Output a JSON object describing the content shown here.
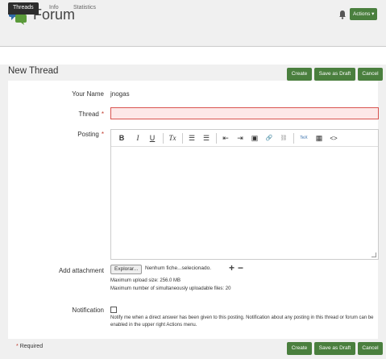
{
  "header": {
    "app_title": "Forum",
    "actions_label": "Actions ▾",
    "bell_icon": "bell-icon",
    "logo_icon": "forum-chat-icon"
  },
  "tabs": [
    {
      "label": "Threads",
      "active": true
    },
    {
      "label": "Info",
      "active": false
    },
    {
      "label": "Statistics",
      "active": false
    }
  ],
  "page": {
    "title": "New Thread",
    "buttons": {
      "create": "Create",
      "save_draft": "Save as Draft",
      "cancel": "Cancel"
    }
  },
  "form": {
    "your_name_label": "Your Name",
    "your_name_value": "jnogas",
    "thread_label": "Thread",
    "thread_value": "",
    "posting_label": "Posting",
    "required_mark": "*",
    "toolbar": {
      "bold": "B",
      "italic": "I",
      "underline": "U",
      "clear_format": "Tx",
      "bullet_list": "☰",
      "numbered_list": "☰",
      "outdent": "⇤",
      "indent": "⇥",
      "image": "▣",
      "link": "🔗",
      "unlink": "⛓",
      "tex": "TeX",
      "media": "▦",
      "code": "<>"
    },
    "attachment_label": "Add attachment",
    "browse_label": "Explorar...",
    "file_status": "Nenhum fiche...selecionado.",
    "plus": "+",
    "minus": "−",
    "max_upload": "Maximum upload size: 256.0 MB",
    "max_files": "Maximum number of simultaneously uploadable files: 20",
    "notification_label": "Notification",
    "notification_text": "Notify me when a direct answer has been given to this posting. Notification about any posting in this thread or forum can be enabled in the upper right Actions menu."
  },
  "footer": {
    "required_note": "Required",
    "required_mark": "*"
  },
  "colors": {
    "accent": "#4a7f3e",
    "error": "#d9534f",
    "error_bg": "#fde8e8",
    "tab_active": "#2d2d2d"
  }
}
